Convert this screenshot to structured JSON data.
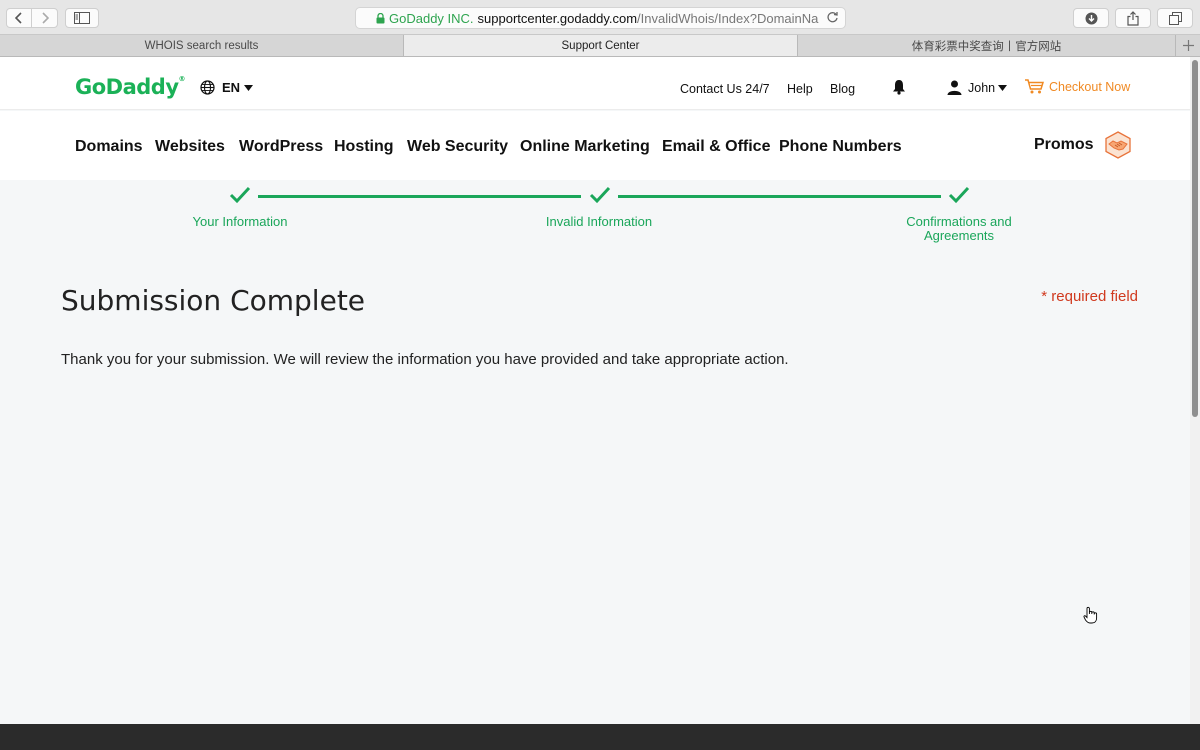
{
  "browser": {
    "address": {
      "org": "GoDaddy INC.",
      "host": "supportcenter.godaddy.com",
      "path": "/InvalidWhois/Index?DomainName=ap"
    },
    "tabs": [
      {
        "label": "WHOIS search results"
      },
      {
        "label": "Support Center"
      },
      {
        "label": "体育彩票中奖查询丨官方网站"
      }
    ]
  },
  "header": {
    "logo": "GoDaddy",
    "lang": "EN",
    "contact": "Contact Us 24/7",
    "help": "Help",
    "blog": "Blog",
    "user": "John",
    "checkout": "Checkout Now"
  },
  "mainnav": {
    "items": [
      "Domains",
      "Websites",
      "WordPress",
      "Hosting",
      "Web Security",
      "Online Marketing",
      "Email & Office",
      "Phone Numbers"
    ],
    "promos": "Promos"
  },
  "progress": {
    "steps": [
      "Your Information",
      "Invalid Information",
      "Confirmations and Agreements"
    ]
  },
  "content": {
    "title": "Submission Complete",
    "required": "* required field",
    "message": "Thank you for your submission. We will review the information you have provided and take appropriate action."
  },
  "colors": {
    "brand_green": "#1bb157",
    "progress_green": "#1aa65a",
    "checkout_orange": "#f08a24",
    "required_red": "#d0391e"
  }
}
